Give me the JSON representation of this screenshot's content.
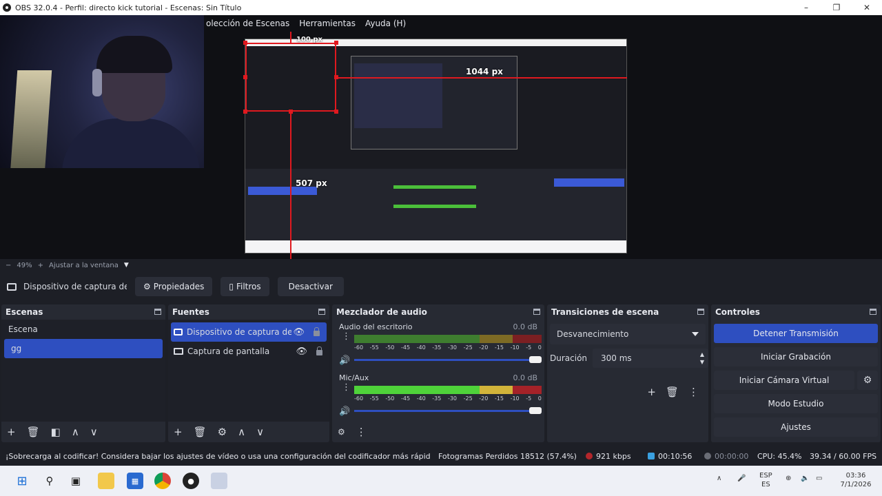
{
  "window": {
    "title": "OBS 32.0.4 - Perfil: directo kick tutorial - Escenas: Sin Título",
    "controls": [
      "–",
      "❐",
      "✕"
    ]
  },
  "menu": {
    "items": [
      "olección de Escenas",
      "Herramientas",
      "Ayuda (H)"
    ]
  },
  "preview": {
    "measure_top": "100 px",
    "measure_right": "1044 px",
    "measure_bottom": "507 px"
  },
  "zoom": {
    "minus": "−",
    "value": "49%",
    "plus": "+",
    "fit_label": "Ajustar a la ventana"
  },
  "source_toolbar": {
    "current_source": "Dispositivo de captura de v",
    "properties_label": "Propiedades",
    "filters_label": "Filtros",
    "deactivate_label": "Desactivar"
  },
  "scenes": {
    "title": "Escenas",
    "items": [
      {
        "label": "Escena",
        "active": false
      },
      {
        "label": "gg",
        "active": true
      }
    ]
  },
  "sources": {
    "title": "Fuentes",
    "items": [
      {
        "label": "Dispositivo de captura de v",
        "icon": "camera-icon",
        "active": true
      },
      {
        "label": "Captura de pantalla",
        "icon": "monitor-icon",
        "active": false
      }
    ]
  },
  "mixer": {
    "title": "Mezclador de audio",
    "channels": [
      {
        "name": "Audio del escritorio",
        "db": "0.0 dB",
        "level": 0.0
      },
      {
        "name": "Mic/Aux",
        "db": "0.0 dB",
        "level": 0.88
      }
    ],
    "ticks": [
      "-60",
      "-55",
      "-50",
      "-45",
      "-40",
      "-35",
      "-30",
      "-25",
      "-20",
      "-15",
      "-10",
      "-5",
      "0"
    ]
  },
  "transitions": {
    "title": "Transiciones de escena",
    "selected": "Desvanecimiento",
    "duration_label": "Duración",
    "duration_value": "300 ms"
  },
  "controls": {
    "title": "Controles",
    "stop_stream": "Detener Transmisión",
    "start_recording": "Iniciar Grabación",
    "start_virtual_cam": "Iniciar Cámara Virtual",
    "studio_mode": "Modo Estudio",
    "settings": "Ajustes"
  },
  "status": {
    "warning": "¡Sobrecarga al codificar! Considera bajar los ajustes de vídeo o usa una configuración del codificador más rápid",
    "dropped": "Fotogramas Perdidos 18512 (57.4%)",
    "bitrate": "921 kbps",
    "stream_time": "00:10:56",
    "rec_time": "00:00:00",
    "cpu": "CPU: 45.4%",
    "fps": "39.34 / 60.00 FPS",
    "colors": {
      "bitrate_dot": "#b3262b",
      "stream_dot": "#3aa0e0",
      "rec_dot": "#6a6d76"
    }
  },
  "taskbar": {
    "lang_top": "ESP",
    "lang_bottom": "ES",
    "time": "03:36",
    "date": "7/1/2026"
  },
  "colors": {
    "accent": "#2e4fc0",
    "panel": "#272a33",
    "selection": "#e0191f"
  }
}
